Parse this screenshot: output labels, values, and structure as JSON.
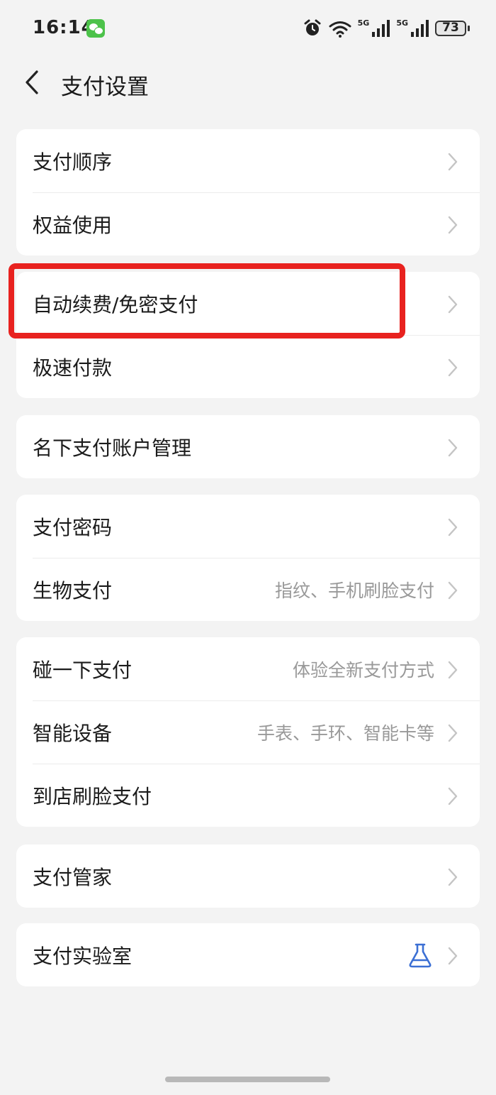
{
  "status_bar": {
    "time": "16:14",
    "net1": "5G",
    "net2": "5G",
    "battery": "73",
    "icons": [
      "wechat-icon",
      "alarm-icon",
      "wifi-icon",
      "signal-icon",
      "signal-icon",
      "battery-icon"
    ]
  },
  "header": {
    "title": "支付设置"
  },
  "groups": [
    {
      "items": [
        {
          "label": "支付顺序"
        },
        {
          "label": "权益使用"
        }
      ]
    },
    {
      "items": [
        {
          "label": "自动续费/免密支付"
        },
        {
          "label": "极速付款"
        }
      ]
    },
    {
      "items": [
        {
          "label": "名下支付账户管理"
        }
      ]
    },
    {
      "items": [
        {
          "label": "支付密码"
        },
        {
          "label": "生物支付",
          "hint": "指纹、手机刷脸支付"
        }
      ]
    },
    {
      "items": [
        {
          "label": "碰一下支付",
          "hint": "体验全新支付方式"
        },
        {
          "label": "智能设备",
          "hint": "手表、手环、智能卡等"
        },
        {
          "label": "到店刷脸支付"
        }
      ]
    },
    {
      "items": [
        {
          "label": "支付管家"
        }
      ]
    },
    {
      "items": [
        {
          "label": "支付实验室",
          "icon": "flask-icon"
        }
      ]
    }
  ],
  "colors": {
    "highlight": "#e8221f",
    "flask": "#3b6fd4",
    "hint": "#999999"
  }
}
